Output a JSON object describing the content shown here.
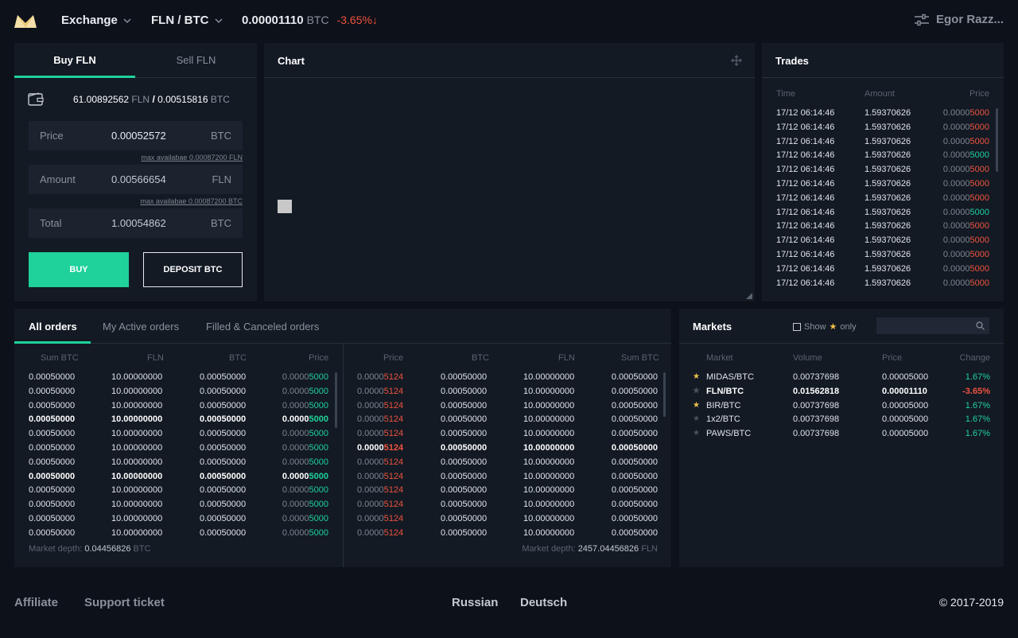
{
  "header": {
    "menu_label": "Exchange",
    "pair_label": "FLN / BTC",
    "last_price": "0.00001110",
    "last_price_unit": "BTC",
    "change": "-3.65%",
    "change_arrow": "↓",
    "user_name": "Egor Razz...",
    "settings_icon": "sliders-icon",
    "accent_color": "#1fd19a",
    "negative_color": "#f0533d"
  },
  "trade_form": {
    "tab_buy": "Buy FLN",
    "tab_sell": "Sell FLN",
    "balance_fln": "61.00892562",
    "balance_fln_unit": "FLN",
    "balance_sep": "/",
    "balance_btc": "0.00515816",
    "balance_btc_unit": "BTC",
    "price_label": "Price",
    "price_value": "0.00052572",
    "price_unit": "BTC",
    "price_hint": "max availabae 0.00087200 FLN",
    "amount_label": "Amount",
    "amount_value": "0.00566654",
    "amount_unit": "FLN",
    "amount_hint": "max availabae 0.00087200 BTC",
    "total_label": "Total",
    "total_value": "1.00054862",
    "total_unit": "BTC",
    "buy_button": "BUY",
    "deposit_button": "DEPOSIT BTC"
  },
  "chart_panel": {
    "title": "Chart"
  },
  "trades": {
    "title": "Trades",
    "columns": [
      "Time",
      "Amount",
      "Price"
    ],
    "rows": [
      {
        "time": "17/12 06:14:46",
        "amount": "1.59370626",
        "price_prefix": "0.0000",
        "price_suffix": "5000",
        "side": "sell"
      },
      {
        "time": "17/12 06:14:46",
        "amount": "1.59370626",
        "price_prefix": "0.0000",
        "price_suffix": "5000",
        "side": "sell"
      },
      {
        "time": "17/12 06:14:46",
        "amount": "1.59370626",
        "price_prefix": "0.0000",
        "price_suffix": "5000",
        "side": "sell"
      },
      {
        "time": "17/12 06:14:46",
        "amount": "1.59370626",
        "price_prefix": "0.0000",
        "price_suffix": "5000",
        "side": "buy"
      },
      {
        "time": "17/12 06:14:46",
        "amount": "1.59370626",
        "price_prefix": "0.0000",
        "price_suffix": "5000",
        "side": "sell"
      },
      {
        "time": "17/12 06:14:46",
        "amount": "1.59370626",
        "price_prefix": "0.0000",
        "price_suffix": "5000",
        "side": "sell"
      },
      {
        "time": "17/12 06:14:46",
        "amount": "1.59370626",
        "price_prefix": "0.0000",
        "price_suffix": "5000",
        "side": "sell"
      },
      {
        "time": "17/12 06:14:46",
        "amount": "1.59370626",
        "price_prefix": "0.0000",
        "price_suffix": "5000",
        "side": "buy"
      },
      {
        "time": "17/12 06:14:46",
        "amount": "1.59370626",
        "price_prefix": "0.0000",
        "price_suffix": "5000",
        "side": "sell"
      },
      {
        "time": "17/12 06:14:46",
        "amount": "1.59370626",
        "price_prefix": "0.0000",
        "price_suffix": "5000",
        "side": "sell"
      },
      {
        "time": "17/12 06:14:46",
        "amount": "1.59370626",
        "price_prefix": "0.0000",
        "price_suffix": "5000",
        "side": "sell"
      },
      {
        "time": "17/12 06:14:46",
        "amount": "1.59370626",
        "price_prefix": "0.0000",
        "price_suffix": "5000",
        "side": "sell"
      },
      {
        "time": "17/12 06:14:46",
        "amount": "1.59370626",
        "price_prefix": "0.0000",
        "price_suffix": "5000",
        "side": "sell"
      }
    ]
  },
  "orders": {
    "tabs": [
      "All orders",
      "My Active orders",
      "Filled & Canceled orders"
    ],
    "bid_columns": [
      "Sum BTC",
      "FLN",
      "BTC",
      "Price"
    ],
    "ask_columns": [
      "Price",
      "BTC",
      "FLN",
      "Sum BTC"
    ],
    "bids": [
      {
        "sum": "0.00050000",
        "fln": "10.00000000",
        "btc": "0.00050000",
        "price_prefix": "0.0000",
        "price_suffix": "5000",
        "bold": false
      },
      {
        "sum": "0.00050000",
        "fln": "10.00000000",
        "btc": "0.00050000",
        "price_prefix": "0.0000",
        "price_suffix": "5000",
        "bold": false
      },
      {
        "sum": "0.00050000",
        "fln": "10.00000000",
        "btc": "0.00050000",
        "price_prefix": "0.0000",
        "price_suffix": "5000",
        "bold": false
      },
      {
        "sum": "0.00050000",
        "fln": "10.00000000",
        "btc": "0.00050000",
        "price_prefix": "0.0000",
        "price_suffix": "5000",
        "bold": true
      },
      {
        "sum": "0.00050000",
        "fln": "10.00000000",
        "btc": "0.00050000",
        "price_prefix": "0.0000",
        "price_suffix": "5000",
        "bold": false
      },
      {
        "sum": "0.00050000",
        "fln": "10.00000000",
        "btc": "0.00050000",
        "price_prefix": "0.0000",
        "price_suffix": "5000",
        "bold": false
      },
      {
        "sum": "0.00050000",
        "fln": "10.00000000",
        "btc": "0.00050000",
        "price_prefix": "0.0000",
        "price_suffix": "5000",
        "bold": false
      },
      {
        "sum": "0.00050000",
        "fln": "10.00000000",
        "btc": "0.00050000",
        "price_prefix": "0.0000",
        "price_suffix": "5000",
        "bold": true
      },
      {
        "sum": "0.00050000",
        "fln": "10.00000000",
        "btc": "0.00050000",
        "price_prefix": "0.0000",
        "price_suffix": "5000",
        "bold": false
      },
      {
        "sum": "0.00050000",
        "fln": "10.00000000",
        "btc": "0.00050000",
        "price_prefix": "0.0000",
        "price_suffix": "5000",
        "bold": false
      },
      {
        "sum": "0.00050000",
        "fln": "10.00000000",
        "btc": "0.00050000",
        "price_prefix": "0.0000",
        "price_suffix": "5000",
        "bold": false
      },
      {
        "sum": "0.00050000",
        "fln": "10.00000000",
        "btc": "0.00050000",
        "price_prefix": "0.0000",
        "price_suffix": "5000",
        "bold": false
      }
    ],
    "asks": [
      {
        "price_prefix": "0.0000",
        "price_suffix": "5124",
        "btc": "0.00050000",
        "fln": "10.00000000",
        "sum": "0.00050000",
        "bold": false
      },
      {
        "price_prefix": "0.0000",
        "price_suffix": "5124",
        "btc": "0.00050000",
        "fln": "10.00000000",
        "sum": "0.00050000",
        "bold": false
      },
      {
        "price_prefix": "0.0000",
        "price_suffix": "5124",
        "btc": "0.00050000",
        "fln": "10.00000000",
        "sum": "0.00050000",
        "bold": false
      },
      {
        "price_prefix": "0.0000",
        "price_suffix": "5124",
        "btc": "0.00050000",
        "fln": "10.00000000",
        "sum": "0.00050000",
        "bold": false
      },
      {
        "price_prefix": "0.0000",
        "price_suffix": "5124",
        "btc": "0.00050000",
        "fln": "10.00000000",
        "sum": "0.00050000",
        "bold": false
      },
      {
        "price_prefix": "0.0000",
        "price_suffix": "5124",
        "btc": "0.00050000",
        "fln": "10.00000000",
        "sum": "0.00050000",
        "bold": true
      },
      {
        "price_prefix": "0.0000",
        "price_suffix": "5124",
        "btc": "0.00050000",
        "fln": "10.00000000",
        "sum": "0.00050000",
        "bold": false
      },
      {
        "price_prefix": "0.0000",
        "price_suffix": "5124",
        "btc": "0.00050000",
        "fln": "10.00000000",
        "sum": "0.00050000",
        "bold": false
      },
      {
        "price_prefix": "0.0000",
        "price_suffix": "5124",
        "btc": "0.00050000",
        "fln": "10.00000000",
        "sum": "0.00050000",
        "bold": false
      },
      {
        "price_prefix": "0.0000",
        "price_suffix": "5124",
        "btc": "0.00050000",
        "fln": "10.00000000",
        "sum": "0.00050000",
        "bold": false
      },
      {
        "price_prefix": "0.0000",
        "price_suffix": "5124",
        "btc": "0.00050000",
        "fln": "10.00000000",
        "sum": "0.00050000",
        "bold": false
      },
      {
        "price_prefix": "0.0000",
        "price_suffix": "5124",
        "btc": "0.00050000",
        "fln": "10.00000000",
        "sum": "0.00050000",
        "bold": false
      }
    ],
    "depth_left_label": "Market depth:",
    "depth_left_value": "0.04456826",
    "depth_left_unit": "BTC",
    "depth_right_label": "Market depth:",
    "depth_right_value": "2457.04456826",
    "depth_right_unit": "FLN"
  },
  "markets": {
    "title": "Markets",
    "show_label": "Show",
    "only_label": "only",
    "search_placeholder": "",
    "columns": [
      "Market",
      "Volume",
      "Price",
      "Change"
    ],
    "rows": [
      {
        "starred": true,
        "name": "MIDAS/BTC",
        "volume": "0.00737698",
        "price": "0.00005000",
        "change": "1.67%",
        "dir": "up",
        "bold": false
      },
      {
        "starred": false,
        "name": "FLN/BTC",
        "volume": "0.01562818",
        "price": "0.00001110",
        "change": "-3.65%",
        "dir": "down",
        "bold": true
      },
      {
        "starred": true,
        "name": "BIR/BTC",
        "volume": "0.00737698",
        "price": "0.00005000",
        "change": "1.67%",
        "dir": "up",
        "bold": false
      },
      {
        "starred": false,
        "name": "1x2/BTC",
        "volume": "0.00737698",
        "price": "0.00005000",
        "change": "1.67%",
        "dir": "up",
        "bold": false
      },
      {
        "starred": false,
        "name": "PAWS/BTC",
        "volume": "0.00737698",
        "price": "0.00005000",
        "change": "1.67%",
        "dir": "up",
        "bold": false
      }
    ]
  },
  "footer": {
    "affiliate": "Affiliate",
    "support": "Support ticket",
    "lang_ru": "Russian",
    "lang_de": "Deutsch",
    "copyright": "© 2017-2019"
  }
}
